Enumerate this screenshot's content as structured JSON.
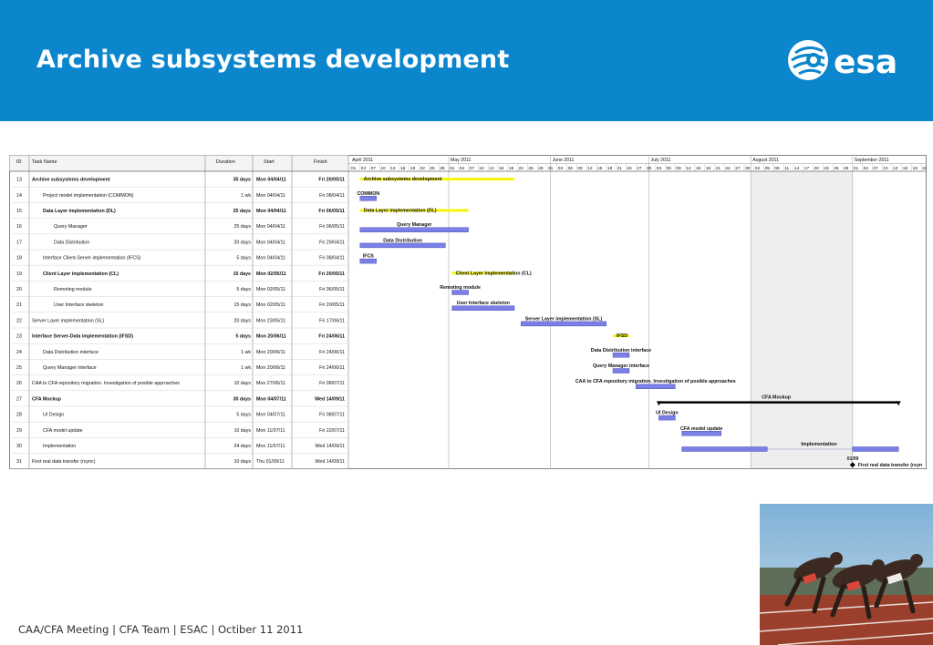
{
  "slide": {
    "title": "Archive subsystems development",
    "footer": "CAA/CFA Meeting | CFA Team | ESAC | Octiber 11 2011",
    "logo_text": "esa",
    "colors": {
      "header_blue": "#0b86cd",
      "bar_blue": "#7b7fe8",
      "summary_yellow": "#f5f50a"
    }
  },
  "gantt": {
    "columns": {
      "id": "ID",
      "name": "Task Name",
      "duration": "Duration",
      "start": "Start",
      "finish": "Finish"
    },
    "months": [
      "April 2011",
      "May 2011",
      "June 2011",
      "July 2011",
      "August 2011",
      "September 2011"
    ],
    "day_ticks": [
      "01",
      "04",
      "07",
      "10",
      "13",
      "16",
      "19",
      "22",
      "25",
      "28",
      "01",
      "04",
      "07",
      "10",
      "13",
      "16",
      "19",
      "22",
      "25",
      "28",
      "31",
      "03",
      "06",
      "09",
      "12",
      "15",
      "18",
      "21",
      "24",
      "27",
      "30",
      "03",
      "06",
      "09",
      "12",
      "15",
      "18",
      "21",
      "24",
      "27",
      "30",
      "02",
      "05",
      "08",
      "11",
      "14",
      "17",
      "20",
      "23",
      "26",
      "29",
      "01",
      "04",
      "07",
      "10",
      "13",
      "16",
      "19",
      "22"
    ],
    "tasks": [
      {
        "id": "13",
        "name": "Archive subsystems development",
        "duration": "35 days",
        "start": "Mon 04/04/11",
        "finish": "Fri 20/05/11",
        "bold": true,
        "indent": 0,
        "type": "summary",
        "bar_label": "Archive subsystems development",
        "label_side": "inside"
      },
      {
        "id": "14",
        "name": "Project model implementation (COMMON)",
        "duration": "1 wk",
        "start": "Mon 04/04/11",
        "finish": "Fri 08/04/11",
        "bold": false,
        "indent": 1,
        "type": "task",
        "bar_label": "COMMON",
        "label_side": "above"
      },
      {
        "id": "15",
        "name": "Data Layer implementation (DL)",
        "duration": "25 days",
        "start": "Mon 04/04/11",
        "finish": "Fri 06/05/11",
        "bold": true,
        "indent": 1,
        "type": "summary",
        "bar_label": "Data Layer implementation (DL)",
        "label_side": "inside"
      },
      {
        "id": "16",
        "name": "Query Manager",
        "duration": "25 days",
        "start": "Mon 04/04/11",
        "finish": "Fri 06/05/11",
        "bold": false,
        "indent": 2,
        "type": "task",
        "bar_label": "Query Manager",
        "label_side": "above"
      },
      {
        "id": "17",
        "name": "Data Distribution",
        "duration": "20 days",
        "start": "Mon 04/04/11",
        "finish": "Fri 29/04/11",
        "bold": false,
        "indent": 2,
        "type": "task",
        "bar_label": "Data Distribution",
        "label_side": "above"
      },
      {
        "id": "18",
        "name": "Interface Client-Server implementation (IFCS)",
        "duration": "5 days",
        "start": "Mon 04/04/11",
        "finish": "Fri 08/04/11",
        "bold": false,
        "indent": 1,
        "type": "task",
        "bar_label": "IFCS",
        "label_side": "above"
      },
      {
        "id": "19",
        "name": "Client Layer implementation (CL)",
        "duration": "15 days",
        "start": "Mon 02/05/11",
        "finish": "Fri 20/05/11",
        "bold": true,
        "indent": 1,
        "type": "summary",
        "bar_label": "Client Layer implementation (CL)",
        "label_side": "inside"
      },
      {
        "id": "20",
        "name": "Remoting module",
        "duration": "5 days",
        "start": "Mon 02/05/11",
        "finish": "Fri 06/05/11",
        "bold": false,
        "indent": 2,
        "type": "task",
        "bar_label": "Remoting module",
        "label_side": "above"
      },
      {
        "id": "21",
        "name": "User Interface skeleton",
        "duration": "15 days",
        "start": "Mon 02/05/11",
        "finish": "Fri 20/05/11",
        "bold": false,
        "indent": 2,
        "type": "task",
        "bar_label": "User Interface skeleton",
        "label_side": "above"
      },
      {
        "id": "22",
        "name": "Server Layer implementation (SL)",
        "duration": "20 days",
        "start": "Mon 23/05/11",
        "finish": "Fri 17/06/11",
        "bold": false,
        "indent": 0,
        "type": "task",
        "bar_label": "Server Layer implementation (SL)",
        "label_side": "above"
      },
      {
        "id": "23",
        "name": "Interface Server-Data implementation (IFSD)",
        "duration": "5 days",
        "start": "Mon 20/06/11",
        "finish": "Fri 24/06/11",
        "bold": true,
        "indent": 0,
        "type": "summary",
        "bar_label": "IFSD",
        "label_side": "inside"
      },
      {
        "id": "24",
        "name": "Data Distribution interface",
        "duration": "1 wk",
        "start": "Mon 20/06/11",
        "finish": "Fri 24/06/11",
        "bold": false,
        "indent": 1,
        "type": "task",
        "bar_label": "Data Distribution interface",
        "label_side": "above"
      },
      {
        "id": "25",
        "name": "Query Manager interface",
        "duration": "1 wk",
        "start": "Mon 20/06/11",
        "finish": "Fri 24/06/11",
        "bold": false,
        "indent": 1,
        "type": "task",
        "bar_label": "Query Manager interface",
        "label_side": "above"
      },
      {
        "id": "26",
        "name": "CAA to CFA repository migration. Investigation of posible approaches",
        "duration": "10 days",
        "start": "Mon 27/06/11",
        "finish": "Fri 08/07/11",
        "bold": false,
        "indent": 0,
        "type": "task",
        "bar_label": "CAA to CFA repository migration. Investigation of posible approaches",
        "label_side": "above"
      },
      {
        "id": "27",
        "name": "CFA Mockup",
        "duration": "30 days",
        "start": "Mon 04/07/11",
        "finish": "Wed 14/09/11",
        "bold": true,
        "indent": 0,
        "type": "mockup",
        "bar_label": "CFA Mockup",
        "label_side": "above"
      },
      {
        "id": "28",
        "name": "UI Design",
        "duration": "5 days",
        "start": "Mon 04/07/11",
        "finish": "Fri 08/07/11",
        "bold": false,
        "indent": 1,
        "type": "task",
        "bar_label": "UI Design",
        "label_side": "above"
      },
      {
        "id": "29",
        "name": "CFA model update",
        "duration": "10 days",
        "start": "Mon 11/07/11",
        "finish": "Fri 22/07/11",
        "bold": false,
        "indent": 1,
        "type": "task",
        "bar_label": "CFA model update",
        "label_side": "above"
      },
      {
        "id": "30",
        "name": "Implementation",
        "duration": "24 days",
        "start": "Mon 11/07/11",
        "finish": "Wed 14/09/11",
        "bold": false,
        "indent": 1,
        "type": "split",
        "bar_label": "Implementation",
        "label_side": "above"
      },
      {
        "id": "31",
        "name": "First real data transfer (rsync)",
        "duration": "10 days",
        "start": "Thu 01/09/11",
        "finish": "Wed 14/09/11",
        "bold": false,
        "indent": 0,
        "type": "milestone",
        "bar_label": "First real data transfer (rsyn",
        "milestone_date": "01/09",
        "label_side": "right"
      }
    ]
  }
}
